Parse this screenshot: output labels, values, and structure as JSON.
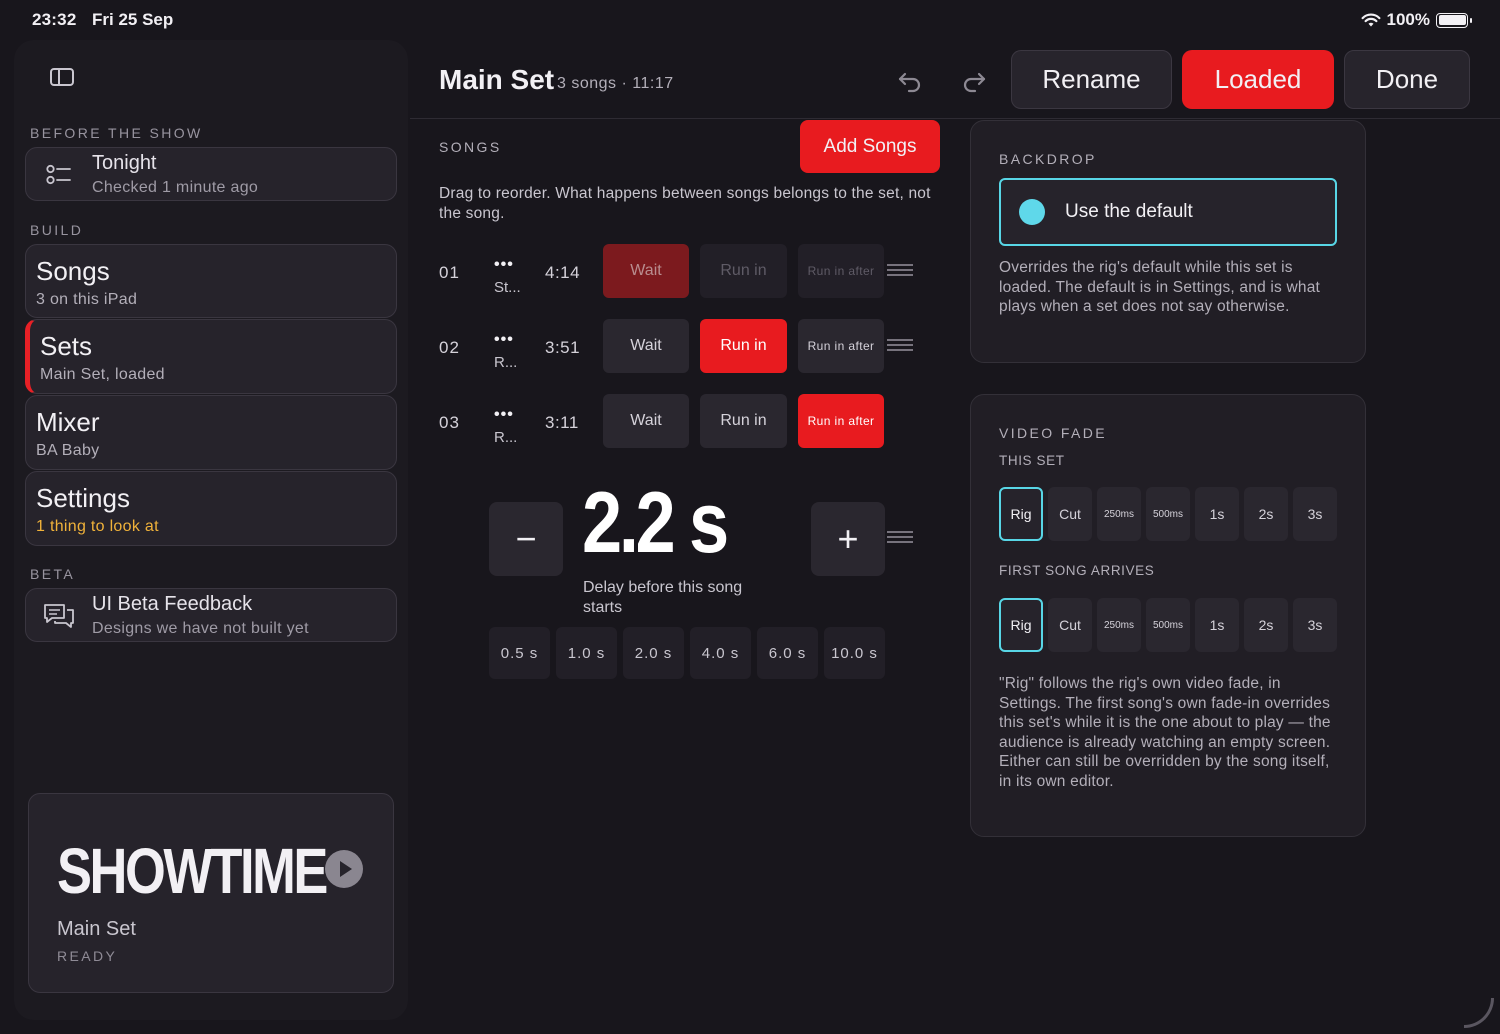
{
  "status": {
    "time": "23:32",
    "date": "Fri 25 Sep",
    "battery": "100%"
  },
  "sidebar": {
    "before_label": "BEFORE THE SHOW",
    "tonight": {
      "title": "Tonight",
      "sub": "Checked 1 minute ago"
    },
    "build_label": "BUILD",
    "items": [
      {
        "title": "Songs",
        "sub": "3 on this iPad"
      },
      {
        "title": "Sets",
        "sub": "Main Set, loaded"
      },
      {
        "title": "Mixer",
        "sub": "BA Baby"
      },
      {
        "title": "Settings",
        "sub": "1 thing to look at"
      }
    ],
    "beta_label": "BETA",
    "beta": {
      "title": "UI Beta Feedback",
      "sub": "Designs we have not built yet"
    },
    "showtime": {
      "title": "SHOWTIME",
      "set": "Main Set",
      "state": "READY"
    }
  },
  "header": {
    "title": "Main Set",
    "meta": "3 songs · 11:17",
    "rename": "Rename",
    "loaded": "Loaded",
    "done": "Done"
  },
  "songs": {
    "label": "SONGS",
    "add": "Add Songs",
    "help": "Drag to reorder. What happens between songs belongs to the set, not the song.",
    "options": {
      "wait": "Wait",
      "run_in": "Run in",
      "run_in_after": "Run in after"
    },
    "rows": [
      {
        "num": "01",
        "dots": "•••",
        "name": "St...",
        "dur": "4:14",
        "selected": "wait"
      },
      {
        "num": "02",
        "dots": "•••",
        "name": "R...",
        "dur": "3:51",
        "selected": "run_in"
      },
      {
        "num": "03",
        "dots": "•••",
        "name": "R...",
        "dur": "3:11",
        "selected": "run_in_after"
      }
    ],
    "delay": {
      "minus": "−",
      "plus": "+",
      "value": "2.2 s",
      "caption": "Delay before this song starts",
      "presets": [
        "0.5 s",
        "1.0 s",
        "2.0 s",
        "4.0 s",
        "6.0 s",
        "10.0 s"
      ]
    }
  },
  "backdrop": {
    "label": "BACKDROP",
    "option": "Use the default",
    "help": "Overrides the rig's default while this set is loaded. The default is in Settings, and is what plays when a set does not say otherwise."
  },
  "video_fade": {
    "label": "VIDEO FADE",
    "this_set_label": "THIS SET",
    "first_song_label": "FIRST SONG ARRIVES",
    "options": [
      "Rig",
      "Cut",
      "250ms",
      "500ms",
      "1s",
      "2s",
      "3s"
    ],
    "this_set_selected": "Rig",
    "first_song_selected": "Rig",
    "help": "\"Rig\" follows the rig's own video fade, in Settings. The first song's own fade-in overrides this set's while it is the one about to play — the audience is already watching an empty screen. Either can still be overridden by the song itself, in its own editor."
  },
  "colors": {
    "accent_red": "#e81b1f",
    "accent_cyan": "#58d6e6",
    "warning": "#f0b23a"
  }
}
